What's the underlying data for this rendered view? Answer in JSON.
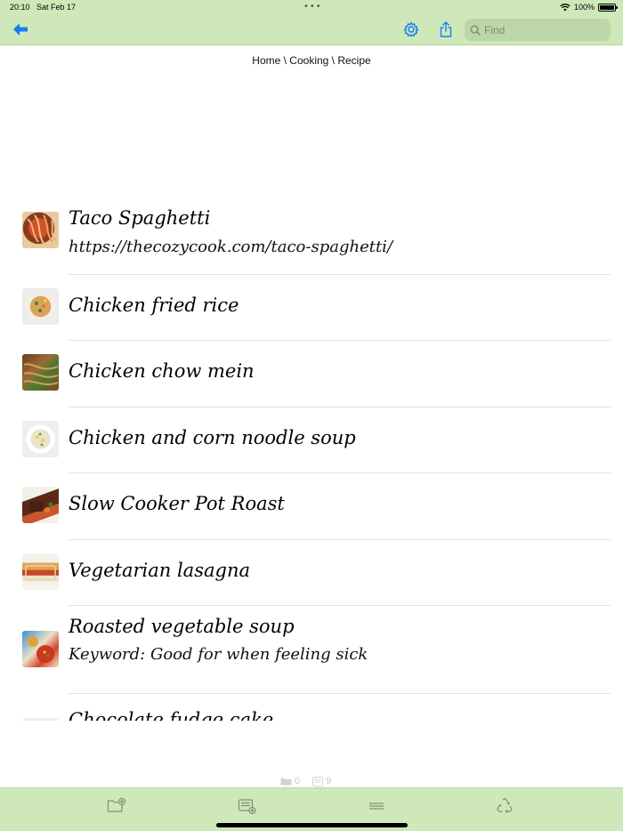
{
  "status_bar": {
    "time": "20:10",
    "date": "Sat Feb 17",
    "battery": "100%"
  },
  "toolbar": {
    "search_placeholder": "Find"
  },
  "breadcrumb": "Home \\ Cooking \\ Recipe",
  "recipes": [
    {
      "title": "Taco Spaghetti",
      "subtitle": "https://thecozycook.com/taco-spaghetti/"
    },
    {
      "title": "Chicken fried rice",
      "subtitle": ""
    },
    {
      "title": "Chicken chow mein",
      "subtitle": ""
    },
    {
      "title": "Chicken and corn noodle soup",
      "subtitle": ""
    },
    {
      "title": "Slow Cooker Pot Roast",
      "subtitle": ""
    },
    {
      "title": "Vegetarian lasagna",
      "subtitle": ""
    },
    {
      "title": "Roasted vegetable soup",
      "subtitle": "Keyword: Good for when feeling sick"
    },
    {
      "title": "Chocolate fudge cake",
      "subtitle": ""
    }
  ],
  "counts": {
    "folders": "0",
    "items": "9"
  },
  "colors": {
    "bar": "#cfe8b9",
    "accent": "#1a7cf5"
  }
}
